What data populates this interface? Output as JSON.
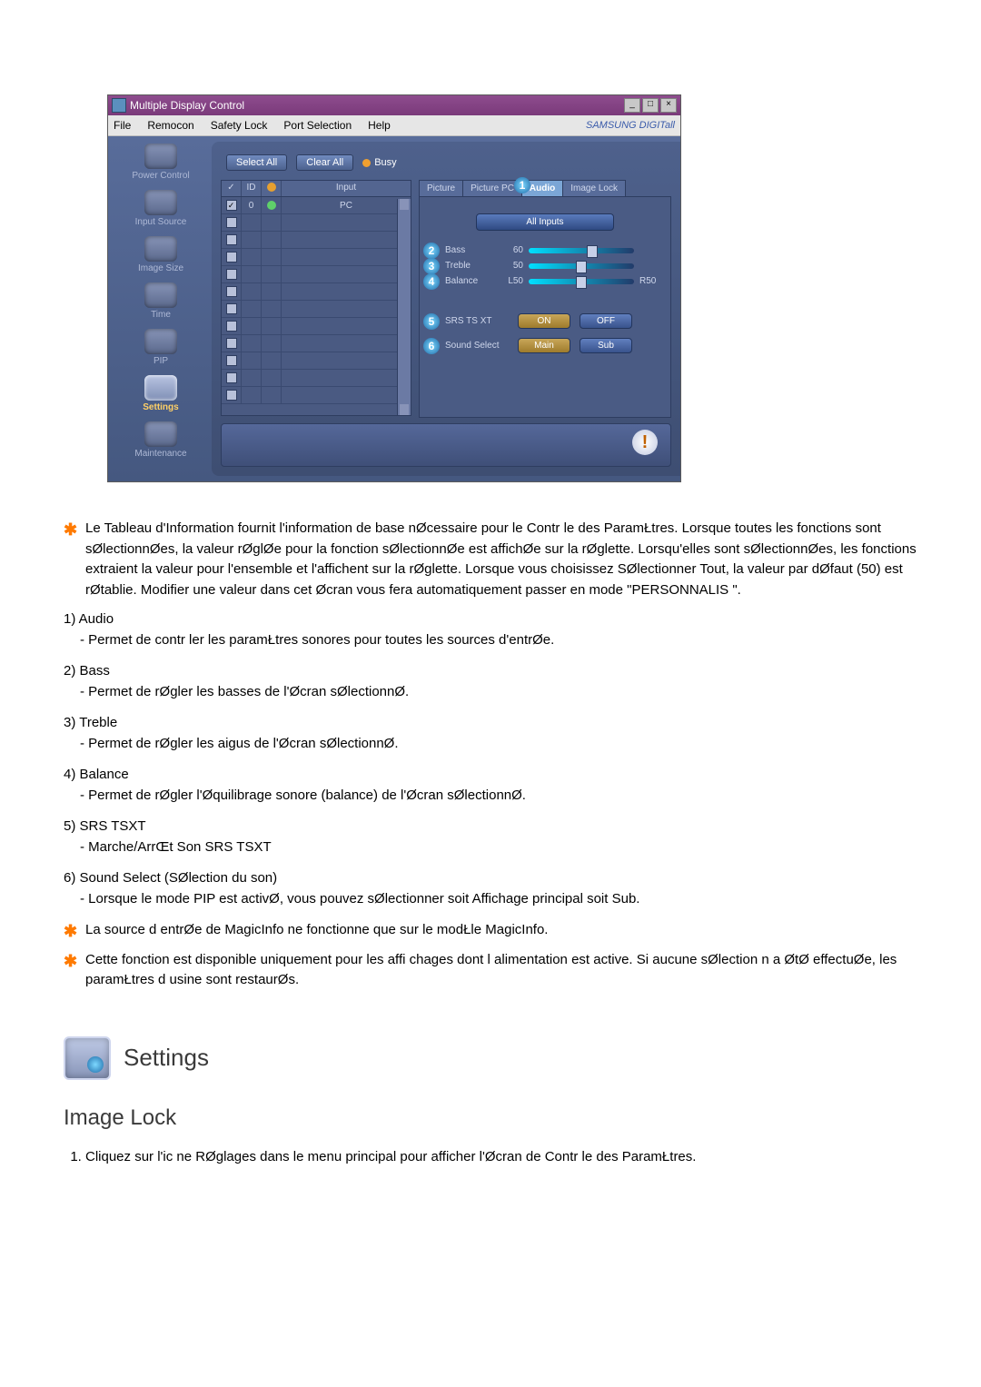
{
  "app_window": {
    "title": "Multiple Display Control",
    "menubar": [
      "File",
      "Remocon",
      "Safety Lock",
      "Port Selection",
      "Help"
    ],
    "brand": "SAMSUNG DIGITall",
    "window_controls": [
      "_",
      "□",
      "×"
    ]
  },
  "sidebar": {
    "items": [
      {
        "label": "Power Control"
      },
      {
        "label": "Input Source"
      },
      {
        "label": "Image Size"
      },
      {
        "label": "Time"
      },
      {
        "label": "PIP"
      },
      {
        "label": "Settings",
        "active": true
      },
      {
        "label": "Maintenance"
      }
    ]
  },
  "top_buttons": {
    "select_all": "Select All",
    "clear_all": "Clear All",
    "busy": "Busy"
  },
  "list": {
    "headers": {
      "chk": "✓",
      "id": "ID",
      "status": "",
      "input": "Input"
    },
    "first_row": {
      "id": "0",
      "input": "PC"
    },
    "blank_count": 11
  },
  "tabs": {
    "picture": "Picture",
    "picture_pc": "Picture PC",
    "audio": "Audio",
    "audio_badge": "1",
    "image_lock": "Image Lock"
  },
  "controls": {
    "all_inputs": "All Inputs",
    "sliders": [
      {
        "num": "2",
        "label": "Bass",
        "val": "60",
        "pct": 60,
        "r": ""
      },
      {
        "num": "3",
        "label": "Treble",
        "val": "50",
        "pct": 50,
        "r": ""
      },
      {
        "num": "4",
        "label": "Balance",
        "val": "L50",
        "pct": 50,
        "r": "R50"
      }
    ],
    "toggles": [
      {
        "num": "5",
        "label": "SRS TS XT",
        "a": "ON",
        "b": "OFF"
      },
      {
        "num": "6",
        "label": "Sound Select",
        "a": "Main",
        "b": "Sub"
      }
    ]
  },
  "footer_icon": "!",
  "doc": {
    "star1": "Le Tableau d'Information fournit l'information de base nØcessaire pour le Contr le des ParamŁtres. Lorsque toutes les fonctions sont sØlectionnØes, la valeur rØglØe pour la fonction sØlectionnØe est affichØe sur la rØglette. Lorsqu'elles sont sØlectionnØes, les fonctions extraient la valeur pour l'ensemble et l'affichent sur la rØglette. Lorsque vous choisissez SØlectionner Tout, la valeur par dØfaut (50) est rØtablie. Modifier une valeur dans cet Øcran vous fera automatiquement passer en mode \"PERSONNALIS \".",
    "items": [
      {
        "head": "1)  Audio",
        "body": "Permet de contr ler les paramŁtres sonores pour toutes les sources d'entrØe."
      },
      {
        "head": "2)  Bass",
        "body": "Permet de rØgler les basses de l'Øcran sØlectionnØ."
      },
      {
        "head": "3)  Treble",
        "body": "Permet de rØgler les aigus de l'Øcran sØlectionnØ."
      },
      {
        "head": "4)  Balance",
        "body": "Permet de rØgler l'Øquilibrage sonore (balance) de l'Øcran sØlectionnØ."
      },
      {
        "head": "5)  SRS TSXT",
        "body": "Marche/ArrŒt Son SRS TSXT"
      },
      {
        "head": "6)  Sound Select (SØlection du son)",
        "body": "Lorsque le mode PIP est activØ, vous pouvez sØlectionner soit Affichage principal soit Sub."
      }
    ],
    "star2": "La source d entrØe de MagicInfo ne fonctionne que sur le modŁle MagicInfo.",
    "star3": "Cette fonction est disponible uniquement pour les affi          chages dont l alimentation est active. Si aucune sØlection n a ØtØ effectuØe, les paramŁtres d usine sont restaurØs.",
    "settings_title": "Settings",
    "imagelock_title": "Image Lock",
    "imagelock_step1": "Cliquez sur l'ic ne RØglages dans le menu principal pour afficher l'Øcran de Contr le des ParamŁtres."
  }
}
